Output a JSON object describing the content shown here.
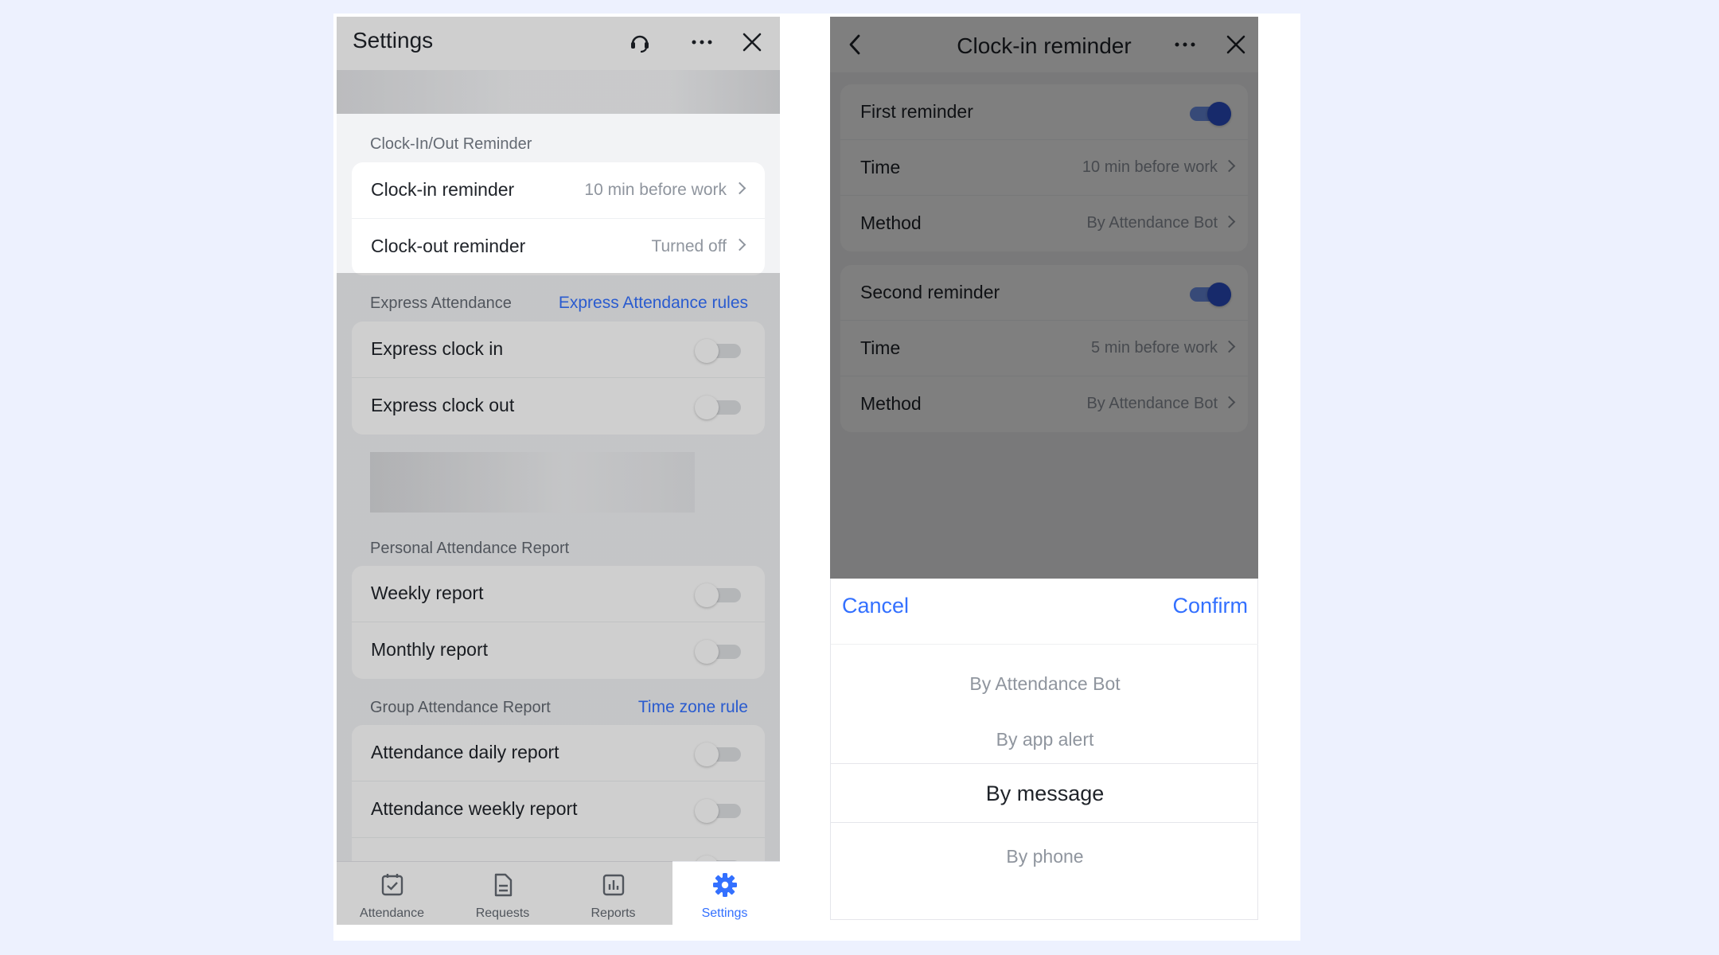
{
  "left": {
    "title": "Settings",
    "header_icons": [
      "headset-icon",
      "more-icon",
      "close-icon"
    ],
    "section_reminder": "Clock-In/Out Reminder",
    "reminders": [
      {
        "label": "Clock-in reminder",
        "value": "10 min before work"
      },
      {
        "label": "Clock-out reminder",
        "value": "Turned off"
      }
    ],
    "section_express": "Express Attendance",
    "express_link": "Express Attendance rules",
    "express": [
      {
        "label": "Express clock in",
        "on": false
      },
      {
        "label": "Express clock out",
        "on": false
      }
    ],
    "section_personal": "Personal Attendance Report",
    "personal": [
      {
        "label": "Weekly report",
        "on": false
      },
      {
        "label": "Monthly report",
        "on": false
      }
    ],
    "section_group": "Group Attendance Report",
    "group_link": "Time zone rule",
    "group": [
      {
        "label": "Attendance daily report",
        "on": false
      },
      {
        "label": "Attendance weekly report",
        "on": false
      }
    ],
    "tabs": [
      {
        "label": "Attendance",
        "icon": "attendance-icon"
      },
      {
        "label": "Requests",
        "icon": "requests-icon"
      },
      {
        "label": "Reports",
        "icon": "reports-icon"
      },
      {
        "label": "Settings",
        "icon": "settings-gear-icon",
        "active": true
      }
    ],
    "accent_color": "#3370ff"
  },
  "right": {
    "title": "Clock-in reminder",
    "first": {
      "label": "First reminder",
      "on": true,
      "time_label": "Time",
      "time_value": "10 min before work",
      "method_label": "Method",
      "method_value": "By Attendance Bot"
    },
    "second": {
      "label": "Second reminder",
      "on": true,
      "time_label": "Time",
      "time_value": "5 min before work",
      "method_label": "Method",
      "method_value": "By Attendance Bot"
    },
    "picker": {
      "cancel": "Cancel",
      "confirm": "Confirm",
      "options": [
        "By Attendance Bot",
        "By app alert",
        "By message",
        "By phone"
      ],
      "selected": "By message"
    }
  }
}
